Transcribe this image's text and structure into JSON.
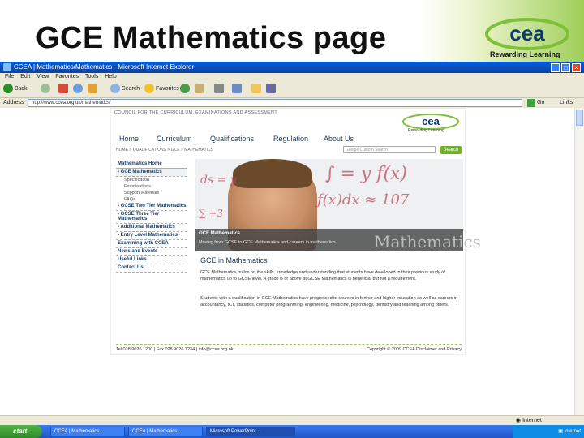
{
  "slide": {
    "title": "GCE Mathematics page",
    "logo_text": "cea",
    "logo_tagline": "Rewarding Learning"
  },
  "browser": {
    "window_title": "CCEA | Mathematics/Mathematics - Microsoft Internet Explorer",
    "menu": [
      "File",
      "Edit",
      "View",
      "Favorites",
      "Tools",
      "Help"
    ],
    "toolbar": {
      "back": "Back",
      "search": "Search",
      "favorites": "Favorites"
    },
    "address_label": "Address",
    "address_url": "http://www.ccea.org.uk/mathematics/",
    "go_label": "Go",
    "links_label": "Links",
    "status_zone": "Internet"
  },
  "site": {
    "strapline": "COUNCIL FOR THE CURRICULUM, EXAMINATIONS AND ASSESSMENT",
    "logo_text": "cea",
    "logo_tagline": "Rewarding Learning",
    "nav": [
      "Home",
      "Curriculum",
      "Qualifications",
      "Regulation",
      "About Us"
    ],
    "breadcrumb": "HOME > QUALIFICATIONS > GCE > MATHEMATICS",
    "search_placeholder": "Google Custom Search",
    "search_button": "Search",
    "sidebar": {
      "heading": "Mathematics Home",
      "items": [
        {
          "label": "GCE Mathematics",
          "active": true
        },
        {
          "label": "Specification",
          "sub": true
        },
        {
          "label": "Examinations",
          "sub": true
        },
        {
          "label": "Support Materials",
          "sub": true
        },
        {
          "label": "FAQs",
          "sub": true
        },
        {
          "label": "GCSE Two Tier Mathematics"
        },
        {
          "label": "GCSE Three Tier Mathematics"
        },
        {
          "label": "Additional Mathematics"
        },
        {
          "label": "Entry Level Mathematics"
        },
        {
          "label": "Examining with CCEA"
        },
        {
          "label": "News and Events"
        },
        {
          "label": "Useful Links"
        },
        {
          "label": "Contact Us"
        }
      ]
    },
    "hero": {
      "caption_title": "GCE Mathematics",
      "caption_text": "Moving from GCSE to GCE Mathematics and careers in mathematics",
      "overlay_word": "Mathematics"
    },
    "content_title": "GCE in Mathematics",
    "paragraph1": "GCE Mathematics builds on the skills, knowledge and understanding that students have developed in their previous study of mathematics up to GCSE level. A grade B or above at GCSE Mathematics is beneficial but not a requirement.",
    "paragraph2": "Students with a qualification in GCE Mathematics have progressed to courses in further and higher education as well as careers in accountancy, ICT, statistics, computer programming, engineering, medicine, psychology, dentistry and teaching among others.",
    "footer_left": "Tel 028 9026 1200 | Fax 028 9026 1234 | info@ccea.org.uk",
    "footer_right": "Copyright © 2009 CCEA    Disclaimer and Privacy"
  },
  "taskbar": {
    "start_label": "start",
    "tasks": [
      "CCEA | Mathematics...",
      "CCEA | Mathematics...",
      "Microsoft PowerPoint..."
    ],
    "tray_text": "Internet"
  }
}
